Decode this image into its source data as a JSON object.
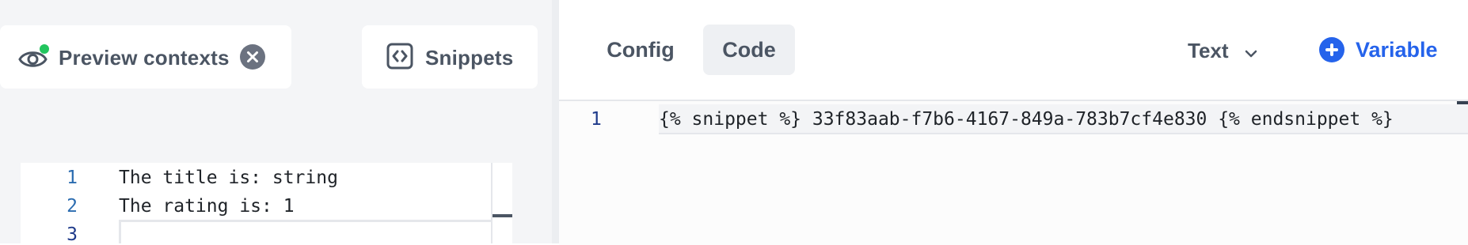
{
  "left_panel": {
    "preview_chip": {
      "label": "Preview contexts",
      "indicator_color": "#22c55e"
    },
    "snippets_chip": {
      "label": "Snippets"
    },
    "editor": {
      "lines": [
        {
          "number": "1",
          "text": "The title is: string"
        },
        {
          "number": "2",
          "text": "The rating is: 1"
        },
        {
          "number": "3",
          "text": ""
        }
      ]
    }
  },
  "right_panel": {
    "tabs": [
      {
        "label": "Config",
        "active": false
      },
      {
        "label": "Code",
        "active": true
      }
    ],
    "mode_select": {
      "value": "Text"
    },
    "variable_button": {
      "label": "Variable",
      "color": "#2563eb"
    },
    "editor": {
      "lines": [
        {
          "number": "1",
          "text": "{% snippet %} 33f83aab-f7b6-4167-849a-783b7cf4e830 {% endsnippet %}"
        }
      ]
    }
  }
}
